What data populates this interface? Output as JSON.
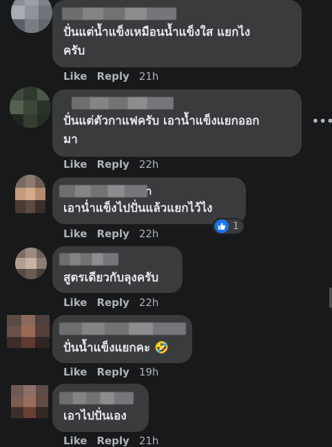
{
  "comments": [
    {
      "text": "ปั่นแต่น้ำแข็งเหมือนน้ำแข็งใส แยกไงครับ",
      "line1": "ปั่นแต่น้ำแข็งเหมือนน้ำแข็งใส แยกไง",
      "line2": "ครับ",
      "like": "Like",
      "reply": "Reply",
      "time": "21h"
    },
    {
      "text": "ปั่นแต่ตัวกาแฟครับ เอาน้ำแข็งแยกออกมา",
      "line1": "ปั่นแต่ตัวกาแฟครับ เอาน้ำแข็งแยกออก",
      "line2": "มา",
      "like": "Like",
      "reply": "Reply",
      "time": "22h"
    },
    {
      "text": "เอาน่ำแข็งไปปั่นแล้วแยกไว้ไง",
      "name_tail": "า",
      "like": "Like",
      "reply": "Reply",
      "time": "22h",
      "reaction_count": "1"
    },
    {
      "text": "สูตรเดียวกับลุงครับ",
      "like": "Like",
      "reply": "Reply",
      "time": "22h"
    },
    {
      "text": "ปั่นน้ำแข็งแยกคะ",
      "emoji": "🤣",
      "like": "Like",
      "reply": "Reply",
      "time": "19h"
    },
    {
      "text": "เอาไปปั่นเอง",
      "like": "Like",
      "reply": "Reply",
      "time": "21h"
    }
  ],
  "more_options": "•••",
  "colors": {
    "background": "#18191a",
    "bubble": "#3a3b3c",
    "text": "#e4e6eb",
    "meta": "#b0b3b8",
    "like_blue": "#1877f2"
  }
}
